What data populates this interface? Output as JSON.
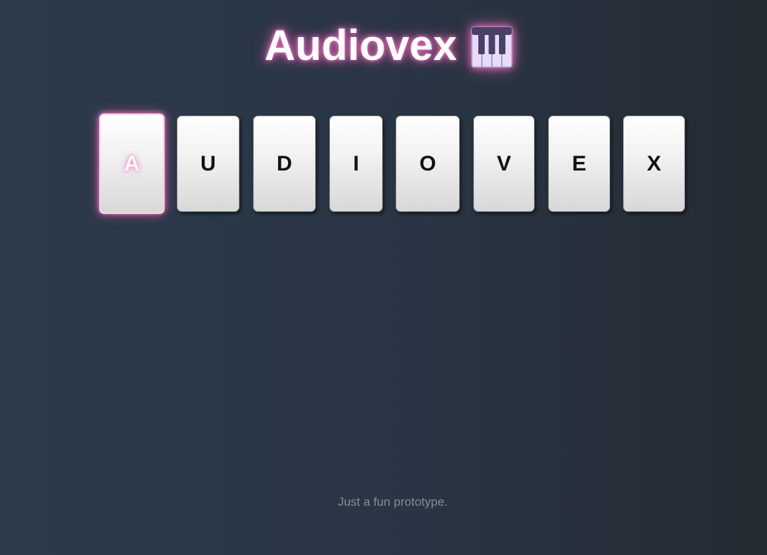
{
  "header": {
    "title": "Audiovex",
    "icon": "piano-keyboard-icon"
  },
  "tiles": [
    {
      "letter": "A",
      "active": true
    },
    {
      "letter": "U",
      "active": false
    },
    {
      "letter": "D",
      "active": false
    },
    {
      "letter": "I",
      "active": false
    },
    {
      "letter": "O",
      "active": false
    },
    {
      "letter": "V",
      "active": false
    },
    {
      "letter": "E",
      "active": false
    },
    {
      "letter": "X",
      "active": false
    }
  ],
  "footer": {
    "text": "Just a fun prototype."
  },
  "colors": {
    "glow": "#ff78c8",
    "background": "#2c3a4b",
    "footer_text": "#858c96"
  }
}
